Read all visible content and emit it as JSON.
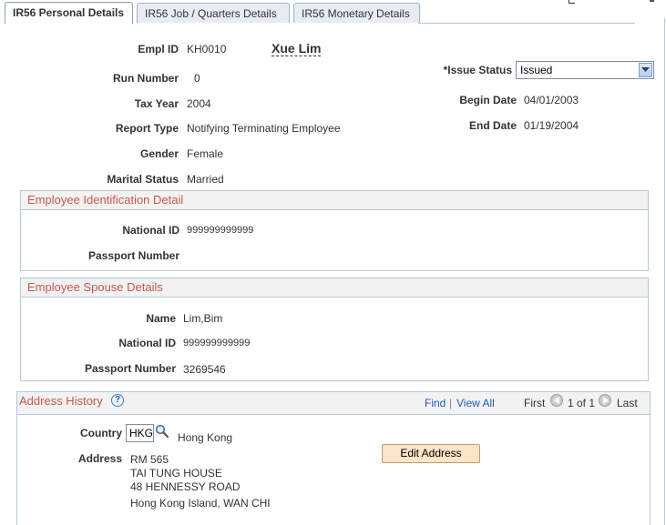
{
  "tabs": [
    {
      "label": "IR56 Personal Details",
      "active": true
    },
    {
      "label": "IR56 Job / Quarters Details",
      "active": false
    },
    {
      "label": "IR56 Monetary Details",
      "active": false
    }
  ],
  "personal": {
    "empl_id_label": "Empl ID",
    "empl_id": "KH0010",
    "name": "Xue Lim",
    "run_number_label": "Run Number",
    "run_number": "0",
    "tax_year_label": "Tax Year",
    "tax_year": "2004",
    "report_type_label": "Report Type",
    "report_type": "Notifying Terminating Employee",
    "gender_label": "Gender",
    "gender": "Female",
    "marital_status_label": "Marital Status",
    "marital_status": "Married",
    "issue_status_label": "*Issue Status",
    "issue_status": "Issued",
    "begin_date_label": "Begin Date",
    "begin_date": "04/01/2003",
    "end_date_label": "End Date",
    "end_date": "01/19/2004"
  },
  "identification": {
    "title": "Employee Identification Detail",
    "national_id_label": "National ID",
    "national_id": "999999999999",
    "passport_label": "Passport Number",
    "passport": ""
  },
  "spouse": {
    "title": "Employee Spouse Details",
    "name_label": "Name",
    "name": "Lim,Bim",
    "national_id_label": "National ID",
    "national_id": "999999999999",
    "passport_label": "Passport Number",
    "passport": "3269546"
  },
  "address": {
    "title": "Address History",
    "help": "?",
    "find": "Find",
    "separator": "|",
    "view_all": "View All",
    "first": "First",
    "paging": "1 of 1",
    "last": "Last",
    "country_label": "Country",
    "country_code": "HKG",
    "country_name": "Hong Kong",
    "address_label": "Address",
    "lines": [
      "RM 565",
      "TAI TUNG HOUSE",
      "48 HENNESSY ROAD",
      "Hong Kong Island, WAN CHI"
    ],
    "edit_button": "Edit Address"
  }
}
